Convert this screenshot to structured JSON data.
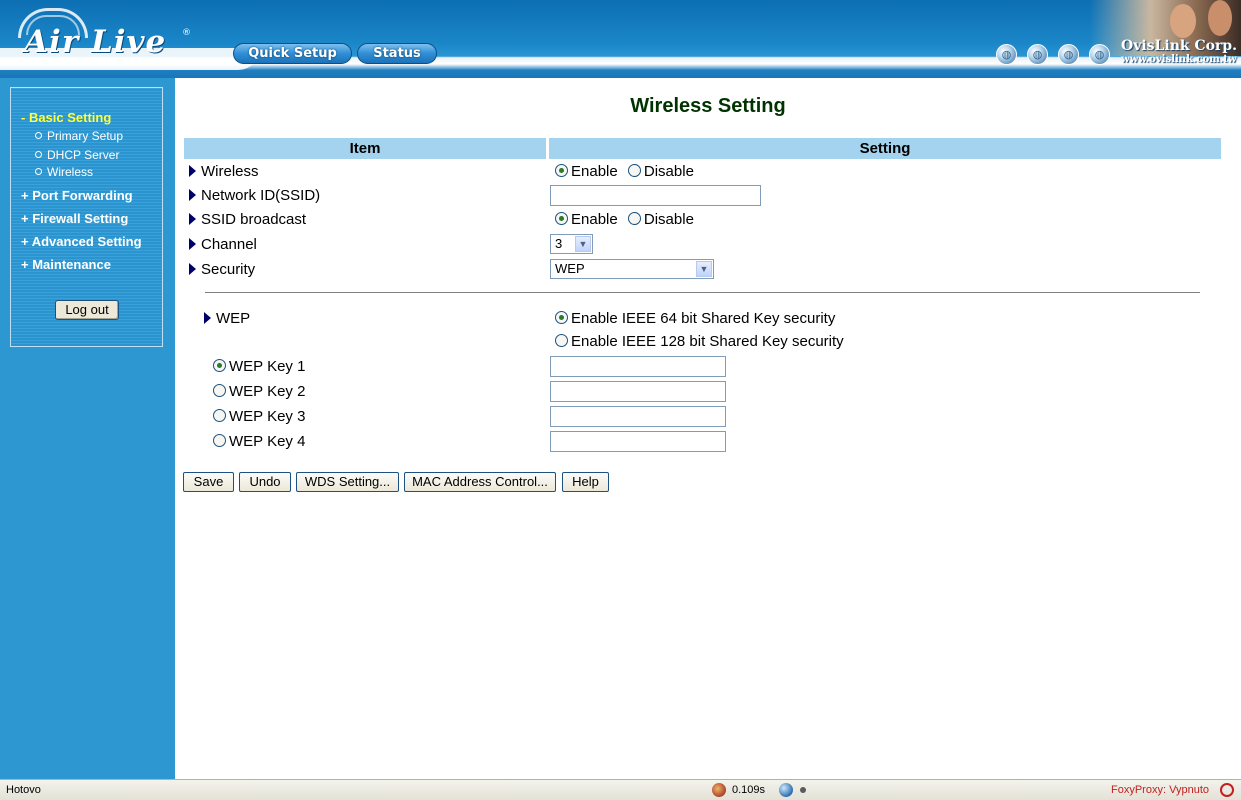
{
  "header": {
    "logo_text": "Air Live",
    "logo_reg": "®",
    "nav_buttons": [
      "Quick Setup",
      "Status"
    ],
    "company_name": "OvisLink Corp.",
    "company_url": "www.ovislink.com.tw",
    "globe_icon_count": 4
  },
  "sidebar": {
    "sections": [
      {
        "label": "- Basic Setting",
        "active": true
      },
      {
        "label": "+ Port Forwarding"
      },
      {
        "label": "+ Firewall Setting"
      },
      {
        "label": "+ Advanced Setting"
      },
      {
        "label": "+ Maintenance"
      }
    ],
    "basic_sub_items": [
      "Primary Setup",
      "DHCP Server",
      "Wireless"
    ],
    "logout_label": "Log out"
  },
  "main": {
    "title": "Wireless Setting",
    "table_headers": {
      "item": "Item",
      "setting": "Setting"
    },
    "rows": {
      "wireless": {
        "label": "Wireless",
        "options": [
          "Enable",
          "Disable"
        ],
        "selected": "Enable"
      },
      "ssid": {
        "label": "Network ID(SSID)",
        "value": ""
      },
      "ssid_broadcast": {
        "label": "SSID broadcast",
        "options": [
          "Enable",
          "Disable"
        ],
        "selected": "Enable"
      },
      "channel": {
        "label": "Channel",
        "value": "3"
      },
      "security": {
        "label": "Security",
        "value": "WEP"
      }
    },
    "wep": {
      "label": "WEP",
      "options": [
        "Enable IEEE 64 bit Shared Key security",
        "Enable IEEE 128 bit Shared Key security"
      ],
      "selected": "Enable IEEE 64 bit Shared Key security",
      "keys": [
        {
          "label": "WEP Key 1",
          "selected": true,
          "value": ""
        },
        {
          "label": "WEP Key 2",
          "selected": false,
          "value": ""
        },
        {
          "label": "WEP Key 3",
          "selected": false,
          "value": ""
        },
        {
          "label": "WEP Key 4",
          "selected": false,
          "value": ""
        }
      ]
    },
    "buttons": [
      "Save",
      "Undo",
      "WDS Setting...",
      "MAC Address Control...",
      "Help"
    ]
  },
  "statusbar": {
    "status_text": "Hotovo",
    "time_text": "0.109s",
    "proxy_text": "FoxyProxy: Vypnuto"
  },
  "colors": {
    "header_blue": "#1a86c8",
    "sidebar_blue": "#2c97d1",
    "active_menu": "#ffff3c",
    "table_header": "#a3d3ef",
    "title_green": "#003300",
    "proxy_red": "#c22020"
  }
}
